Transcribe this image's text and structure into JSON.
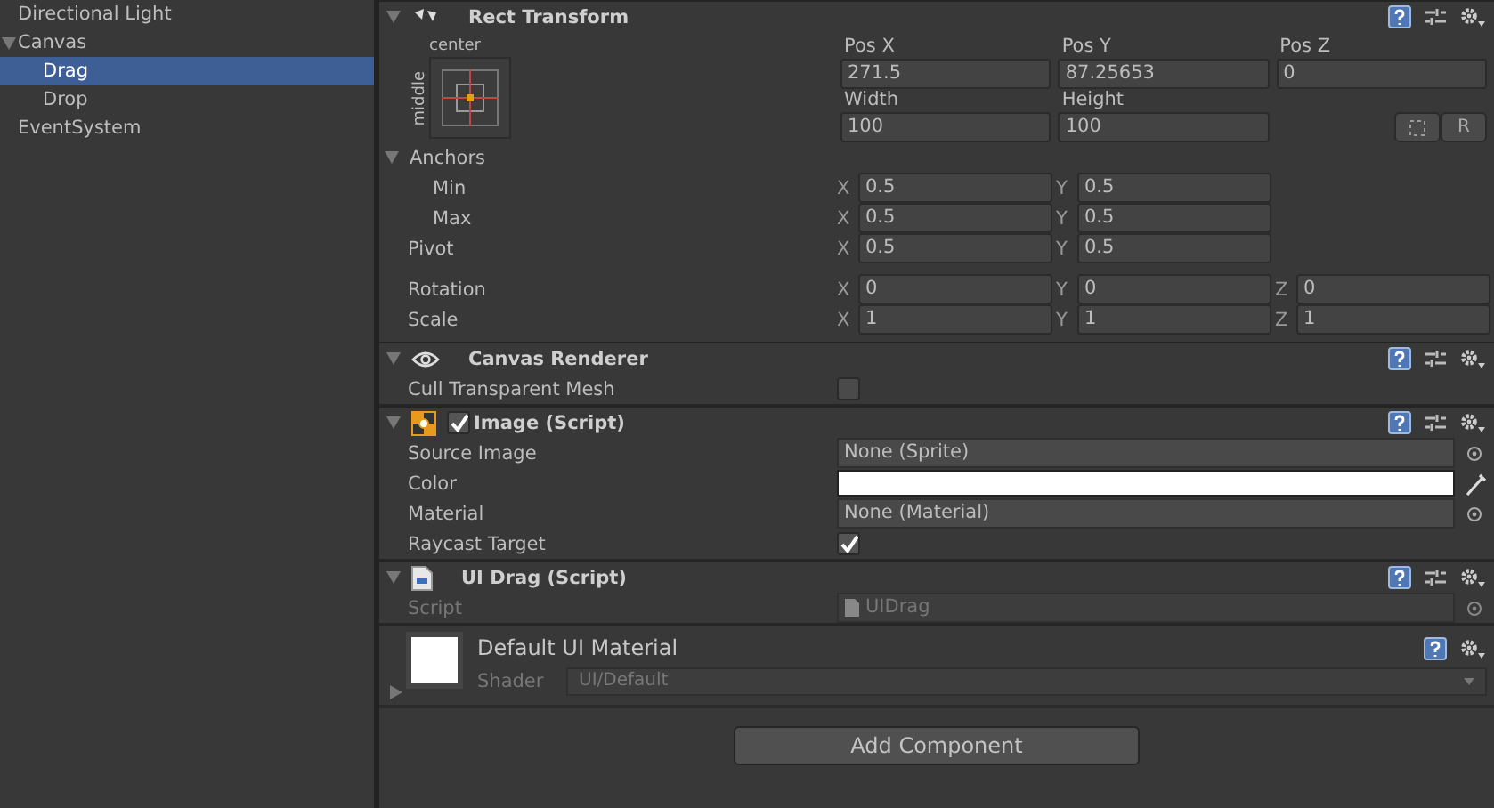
{
  "hierarchy": {
    "items": [
      {
        "label": "Directional Light",
        "selected": false
      },
      {
        "label": "Canvas",
        "selected": false,
        "expanded": true,
        "children": [
          {
            "label": "Drag",
            "selected": true
          },
          {
            "label": "Drop",
            "selected": false
          }
        ]
      },
      {
        "label": "EventSystem",
        "selected": false
      }
    ]
  },
  "rect_transform": {
    "title": "Rect Transform",
    "expanded": true,
    "anchor_h": "center",
    "anchor_v": "middle",
    "position": [
      {
        "label": "Pos X",
        "value": "271.5"
      },
      {
        "label": "Pos Y",
        "value": "87.25653"
      },
      {
        "label": "Pos Z",
        "value": "0"
      }
    ],
    "size": [
      {
        "label": "Width",
        "value": "100"
      },
      {
        "label": "Height",
        "value": "100"
      }
    ],
    "raw_button": "R",
    "anchors": {
      "label": "Anchors",
      "expanded": true,
      "rows": [
        {
          "label": "Min",
          "parts": [
            {
              "axis": "X",
              "value": "0.5"
            },
            {
              "axis": "Y",
              "value": "0.5"
            }
          ]
        },
        {
          "label": "Max",
          "parts": [
            {
              "axis": "X",
              "value": "0.5"
            },
            {
              "axis": "Y",
              "value": "0.5"
            }
          ]
        }
      ]
    },
    "rows": [
      {
        "label": "Pivot",
        "parts": [
          {
            "axis": "X",
            "value": "0.5"
          },
          {
            "axis": "Y",
            "value": "0.5"
          }
        ]
      },
      {
        "label": "Rotation",
        "parts": [
          {
            "axis": "X",
            "value": "0"
          },
          {
            "axis": "Y",
            "value": "0"
          },
          {
            "axis": "Z",
            "value": "0"
          }
        ]
      },
      {
        "label": "Scale",
        "parts": [
          {
            "axis": "X",
            "value": "1"
          },
          {
            "axis": "Y",
            "value": "1"
          },
          {
            "axis": "Z",
            "value": "1"
          }
        ]
      }
    ]
  },
  "components": [
    {
      "kind": "eye",
      "title": "Canvas Renderer",
      "expanded": true,
      "properties": [
        {
          "kind": "checkbox",
          "label": "Cull Transparent Mesh",
          "checked": false,
          "disabled": false
        }
      ]
    },
    {
      "kind": "image",
      "title": "Image (Script)",
      "expanded": true,
      "enabled": true,
      "properties": [
        {
          "kind": "object",
          "label": "Source Image",
          "value": "None (Sprite)",
          "disabled": false
        },
        {
          "kind": "color",
          "label": "Color",
          "color": "#ffffff",
          "disabled": false
        },
        {
          "kind": "object",
          "label": "Material",
          "value": "None (Material)",
          "disabled": false
        },
        {
          "kind": "checkbox",
          "label": "Raycast Target",
          "checked": true,
          "disabled": false
        }
      ]
    },
    {
      "kind": "script",
      "title": "UI Drag (Script)",
      "expanded": true,
      "properties": [
        {
          "kind": "script",
          "label": "Script",
          "value": "UIDrag",
          "disabled": true
        }
      ]
    }
  ],
  "material": {
    "title": "Default UI Material",
    "expanded": false,
    "shader_label": "Shader",
    "shader": "UI/Default"
  },
  "add_component_button": "Add Component"
}
